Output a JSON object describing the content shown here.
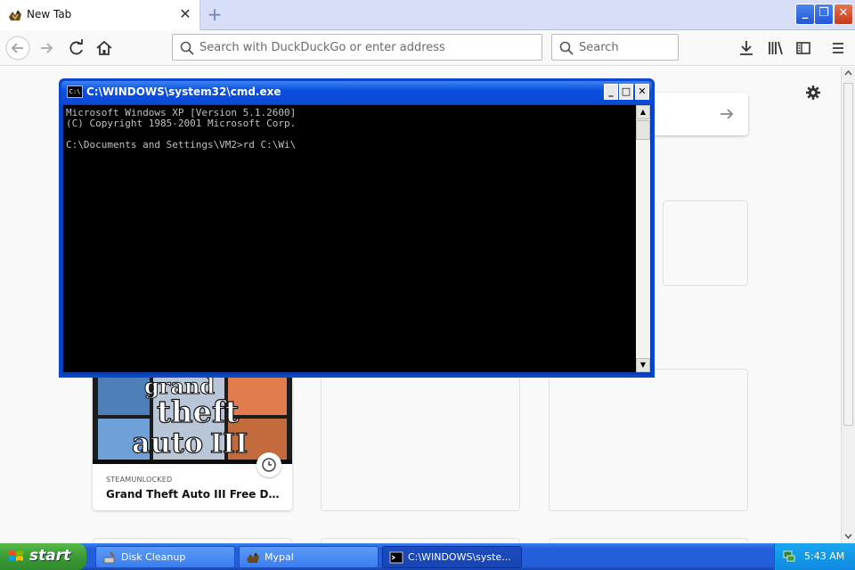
{
  "browser": {
    "tab": {
      "title": "New Tab",
      "favicon": "mypal-icon"
    },
    "new_tab_symbol": "+",
    "url_placeholder": "Search with DuckDuckGo or enter address",
    "search_placeholder": "Search"
  },
  "newtab": {
    "card": {
      "source": "STEAMUNLOCKED",
      "title": "Grand Theft Auto III Free Download",
      "image_text": [
        "grand",
        "theft",
        "auto",
        "III"
      ]
    }
  },
  "cmd": {
    "title": "C:\\WINDOWS\\system32\\cmd.exe",
    "icon_label": "C:\\",
    "lines": [
      "Microsoft Windows XP [Version 5.1.2600]",
      "(C) Copyright 1985-2001 Microsoft Corp.",
      "",
      "C:\\Documents and Settings\\VM2>rd C:\\Wi\\"
    ]
  },
  "taskbar": {
    "start_label": "start",
    "tasks": [
      {
        "label": "Disk Cleanup",
        "icon": "disk-cleanup-icon"
      },
      {
        "label": "Mypal",
        "icon": "mypal-icon"
      },
      {
        "label": "C:\\WINDOWS\\syste...",
        "icon": "cmd-icon"
      }
    ],
    "clock": "5:43 AM"
  },
  "colors": {
    "taskbar_blue": "#245edb",
    "start_green": "#3c9b35",
    "cmd_title_blue": "#0b4fe0",
    "page_bg": "#f9f9fa"
  }
}
